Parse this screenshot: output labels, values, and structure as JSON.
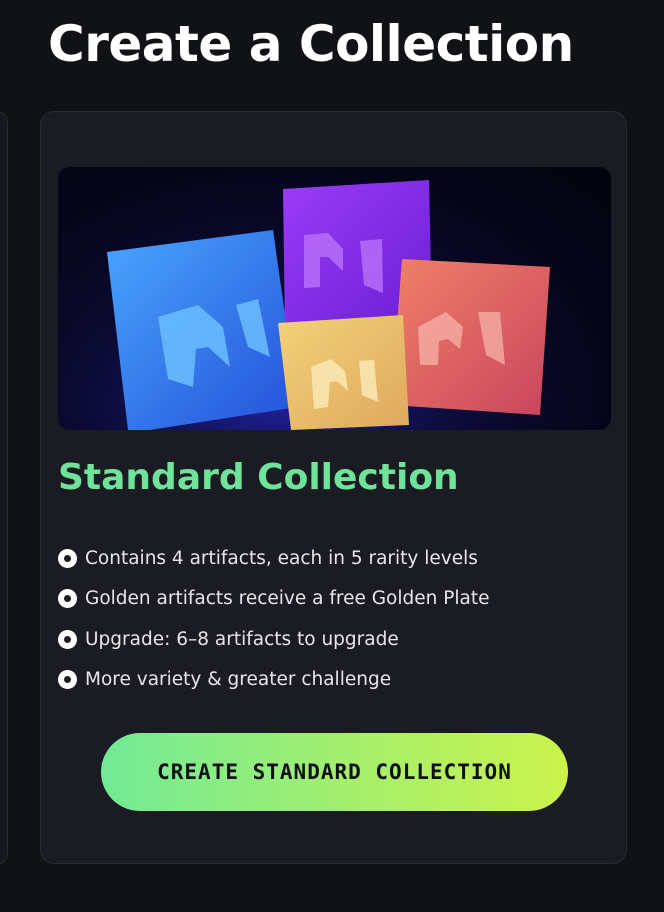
{
  "page": {
    "title": "Create a Collection"
  },
  "card": {
    "title": "Standard Collection",
    "title_color": "#6fe39a",
    "features": [
      "Contains 4 artifacts, each in 5 rarity levels",
      "Golden artifacts receive a free Golden Plate",
      "Upgrade: 6–8 artifacts to upgrade",
      "More variety & greater challenge"
    ],
    "cta_label": "CREATE STANDARD COLLECTION",
    "cta_gradient": [
      "#72ea96",
      "#cbf34c"
    ]
  },
  "hero": {
    "artifacts": [
      {
        "name": "blue-artifact-icon",
        "color": "#3b86f0"
      },
      {
        "name": "purple-artifact-icon",
        "color": "#8a2cf0"
      },
      {
        "name": "red-artifact-icon",
        "color": "#e0645f"
      },
      {
        "name": "gold-artifact-icon",
        "color": "#e8c06a"
      }
    ]
  }
}
